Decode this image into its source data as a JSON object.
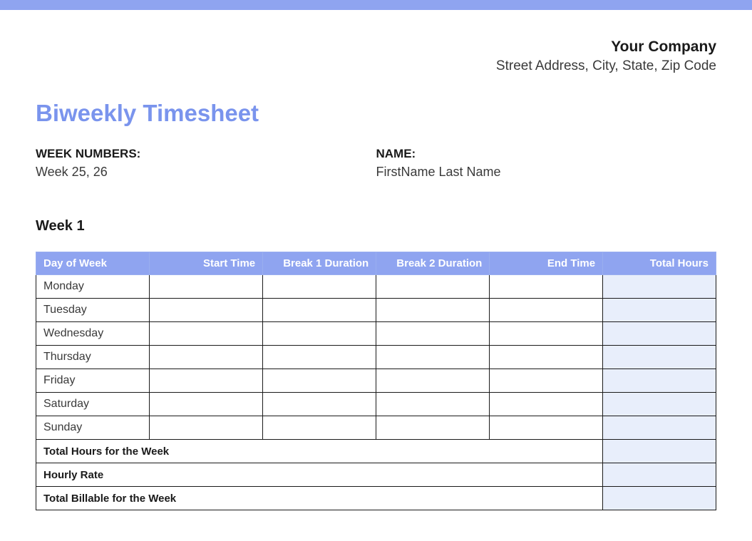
{
  "header": {
    "company_name": "Your Company",
    "company_address": "Street Address, City, State, Zip Code"
  },
  "title": "Biweekly Timesheet",
  "info": {
    "weeks_label": "WEEK NUMBERS:",
    "weeks_value": "Week 25, 26",
    "name_label": "NAME:",
    "name_value": "FirstName Last Name"
  },
  "week_section": {
    "heading": "Week 1"
  },
  "table": {
    "columns": {
      "day": "Day of Week",
      "start": "Start Time",
      "break1": "Break 1 Duration",
      "break2": "Break 2 Duration",
      "end": "End Time",
      "total": "Total Hours"
    },
    "rows": [
      {
        "day": "Monday",
        "start": "",
        "break1": "",
        "break2": "",
        "end": "",
        "total": ""
      },
      {
        "day": "Tuesday",
        "start": "",
        "break1": "",
        "break2": "",
        "end": "",
        "total": ""
      },
      {
        "day": "Wednesday",
        "start": "",
        "break1": "",
        "break2": "",
        "end": "",
        "total": ""
      },
      {
        "day": "Thursday",
        "start": "",
        "break1": "",
        "break2": "",
        "end": "",
        "total": ""
      },
      {
        "day": "Friday",
        "start": "",
        "break1": "",
        "break2": "",
        "end": "",
        "total": ""
      },
      {
        "day": "Saturday",
        "start": "",
        "break1": "",
        "break2": "",
        "end": "",
        "total": ""
      },
      {
        "day": "Sunday",
        "start": "",
        "break1": "",
        "break2": "",
        "end": "",
        "total": ""
      }
    ],
    "summary": {
      "total_hours_label": "Total Hours for the Week",
      "total_hours_value": "",
      "hourly_rate_label": "Hourly Rate",
      "hourly_rate_value": "",
      "total_billable_label": "Total Billable for the Week",
      "total_billable_value": ""
    }
  }
}
